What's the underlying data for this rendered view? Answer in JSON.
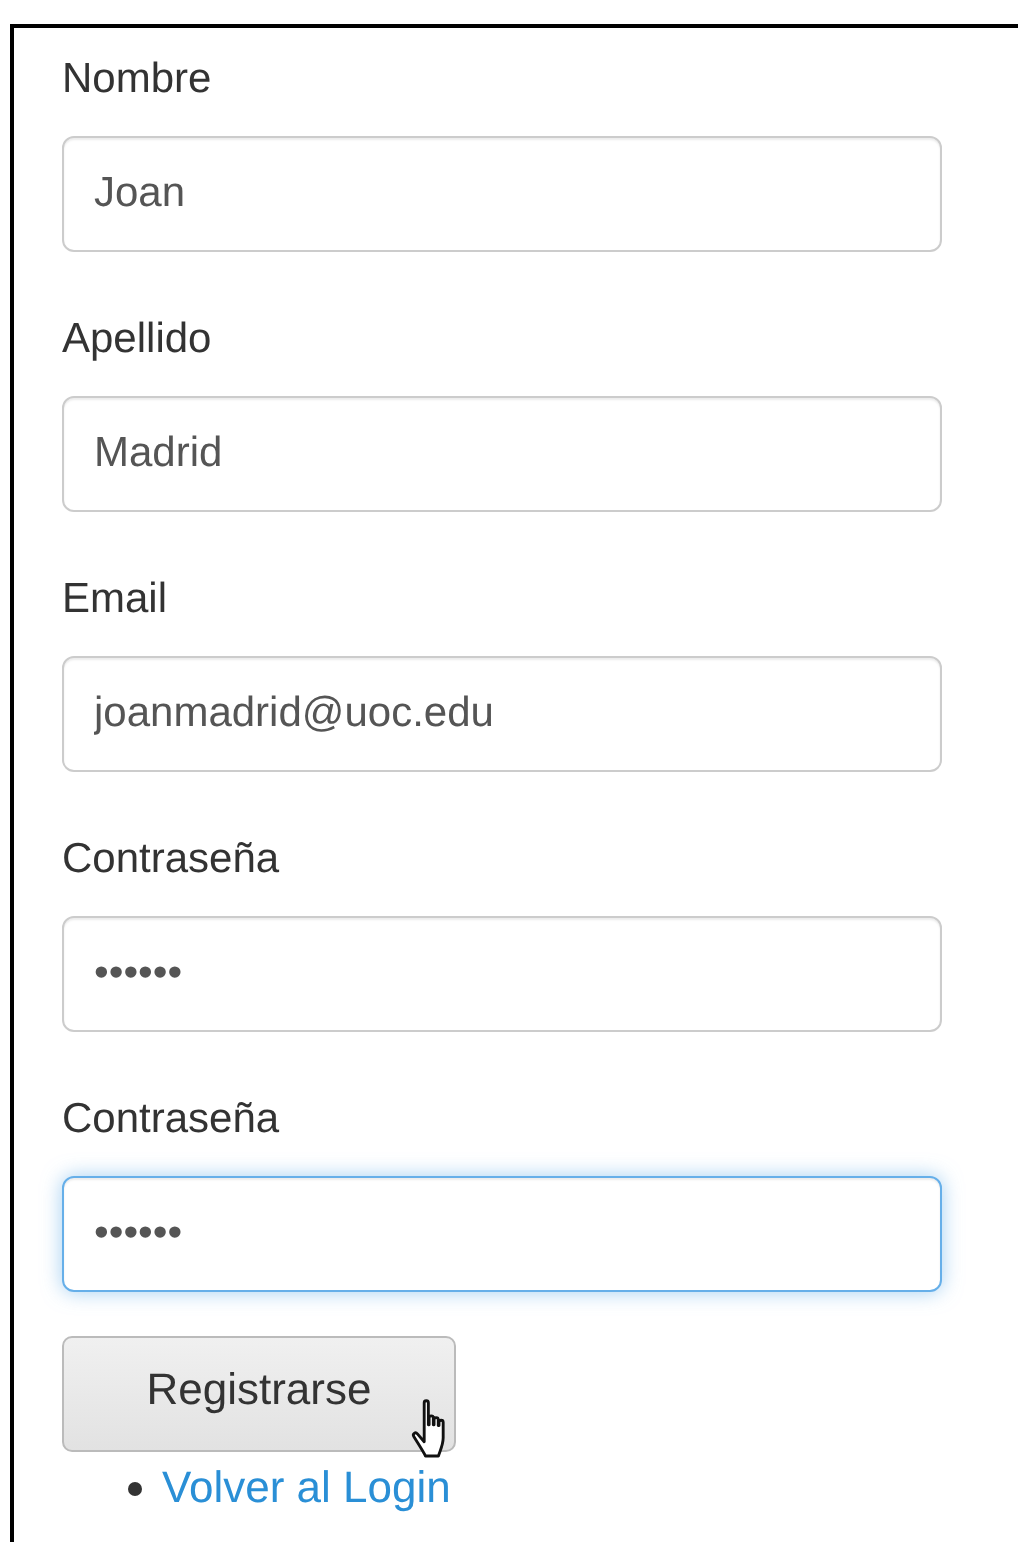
{
  "fields": [
    {
      "label": "Nombre",
      "value": "Joan",
      "focused": false
    },
    {
      "label": "Apellido",
      "value": "Madrid",
      "focused": false
    },
    {
      "label": "Email",
      "value": "joanmadrid@uoc.edu",
      "focused": false
    },
    {
      "label": "Contraseña",
      "value": "••••••",
      "focused": false
    },
    {
      "label": "Contraseña",
      "value": "••••••",
      "focused": true
    }
  ],
  "submit_button": "Registrarse",
  "links": [
    "Volver al Login"
  ]
}
